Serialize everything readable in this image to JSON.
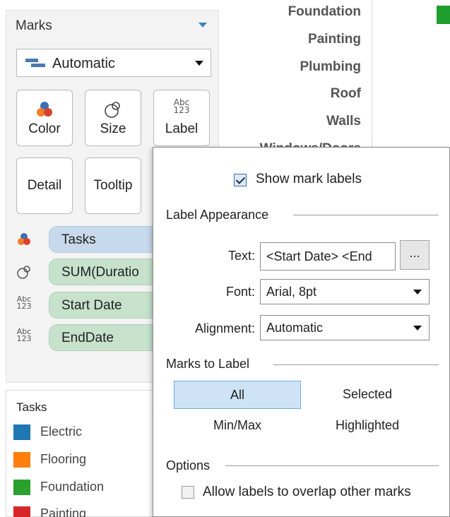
{
  "marks_panel": {
    "title": "Marks",
    "mark_type": "Automatic",
    "cards": {
      "color": "Color",
      "size": "Size",
      "label": "Label",
      "detail": "Detail",
      "tooltip": "Tooltip"
    },
    "abc_icon_text": {
      "line1": "Abc",
      "line2": "123"
    },
    "pills": [
      {
        "field": "Tasks",
        "encoding": "color-icon"
      },
      {
        "field": "SUM(Duratio",
        "encoding": "size-icon"
      },
      {
        "field": "Start Date",
        "encoding": "label-icon"
      },
      {
        "field": "EndDate",
        "encoding": "label-icon"
      }
    ]
  },
  "legend": {
    "title": "Tasks",
    "items": [
      {
        "label": "Electric",
        "color": "#1f77b4"
      },
      {
        "label": "Flooring",
        "color": "#ff7f0e"
      },
      {
        "label": "Foundation",
        "color": "#2ca02c"
      },
      {
        "label": "Painting",
        "color": "#d62728"
      }
    ]
  },
  "axis_labels": [
    "Foundation",
    "Painting",
    "Plumbing",
    "Roof",
    "Walls",
    "Windows/Doors"
  ],
  "label_popup": {
    "show_mark_labels": {
      "label": "Show mark labels",
      "checked": true
    },
    "label_appearance": {
      "title": "Label Appearance",
      "text_label": "Text:",
      "text_value": "<Start Date> <End",
      "dots": "...",
      "font_label": "Font:",
      "font_value": "Arial, 8pt",
      "alignment_label": "Alignment:",
      "alignment_value": "Automatic"
    },
    "marks_to_label": {
      "title": "Marks to Label",
      "options": [
        "All",
        "Selected",
        "Min/Max",
        "Highlighted"
      ],
      "selected": "All"
    },
    "options": {
      "title": "Options",
      "allow_overlap": {
        "label": "Allow labels to overlap other marks",
        "checked": false
      }
    }
  },
  "colors": {
    "accent": "#3e7fbf",
    "pill_dimension": "#c7d9ec",
    "pill_measure": "#c6e2cc",
    "selected_option": "#cfe3f7"
  }
}
